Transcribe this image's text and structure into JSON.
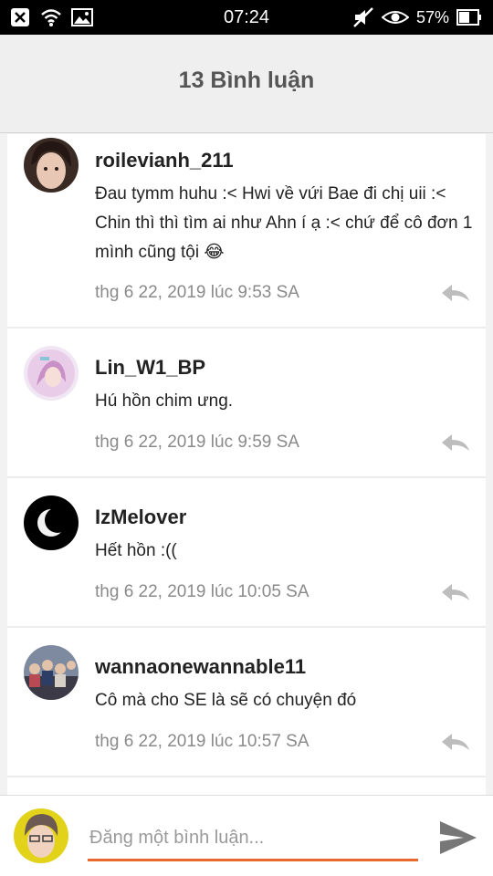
{
  "status_bar": {
    "time": "07:24",
    "battery": "57%",
    "icons_left": [
      "close-icon",
      "wifi-icon",
      "image-icon"
    ],
    "icons_right": [
      "mute-icon",
      "eye-icon",
      "battery-icon"
    ]
  },
  "header": {
    "title": "13 Bình luận"
  },
  "comments": [
    {
      "username": "roilevianh_211",
      "text": "Đau tymm huhu :< Hwi về vứi Bae đi chị uii :< Chin thì thì tìm ai như Ahn í ạ :< chứ để cô đơn 1 mình cũng tội 😂",
      "date": "thg 6 22, 2019 lúc 9:53 SA"
    },
    {
      "username": "Lin_W1_BP",
      "text": "Hú hồn chim ưng.",
      "date": "thg 6 22, 2019 lúc 9:59 SA"
    },
    {
      "username": "IzMelover",
      "text": "Hết hồn :((",
      "date": "thg 6 22, 2019 lúc 10:05 SA"
    },
    {
      "username": "wannaonewannable11",
      "text": "Cô mà cho SE là sẽ có chuyện đó",
      "date": "thg 6 22, 2019 lúc 10:57 SA"
    }
  ],
  "composer": {
    "placeholder": "Đăng một bình luận...",
    "value": ""
  },
  "colors": {
    "accent": "#e76a2c",
    "muted_text": "#8a8a8a",
    "header_bg": "#efefef"
  }
}
